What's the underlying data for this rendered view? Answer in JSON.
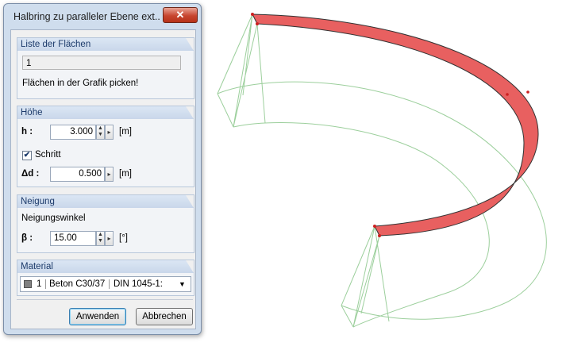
{
  "dialog": {
    "title": "Halbring zu paralleler Ebene ext...",
    "close_label": "✕",
    "groups": {
      "list": {
        "header": "Liste der Flächen",
        "value": "1",
        "hint": "Flächen in der Grafik picken!"
      },
      "height": {
        "header": "Höhe",
        "h_label": "h :",
        "h_value": "3.000",
        "h_unit": "[m]",
        "step_label": "Schritt",
        "step_checked": "✔",
        "delta_label": "Δd :",
        "delta_value": "0.500",
        "delta_unit": "[m]"
      },
      "slope": {
        "header": "Neigung",
        "angle_title": "Neigungswinkel",
        "beta_label": "β :",
        "beta_value": "15.00",
        "beta_unit": "[°]"
      },
      "material": {
        "header": "Material",
        "number": "1",
        "name": "Beton C30/37",
        "norm": "DIN 1045-1:"
      }
    },
    "buttons": {
      "apply": "Anwenden",
      "cancel": "Abbrechen"
    },
    "colors": {
      "accent": "#1d3b6b",
      "close": "#c7452f"
    }
  },
  "viewport": {
    "surface_color": "#e86060",
    "wire_color": "#9ccf9c"
  }
}
